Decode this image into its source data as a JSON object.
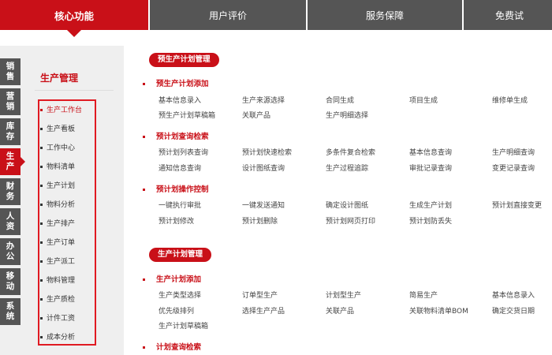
{
  "topnav": {
    "tabs": [
      "核心功能",
      "用户评价",
      "服务保障",
      "免费试"
    ]
  },
  "sidebar": {
    "vtabs": [
      "销售",
      "营销",
      "库存",
      "生产",
      "财务",
      "人资",
      "办公",
      "移动",
      "系统"
    ],
    "active_vtab": "生产",
    "title": "生产管理",
    "items": [
      "生产工作台",
      "生产看板",
      "工作中心",
      "物料清单",
      "生产计划",
      "物料分析",
      "生产排产",
      "生产订单",
      "生产派工",
      "物料管理",
      "生产质检",
      "计件工资",
      "成本分析"
    ],
    "active_item": "生产工作台"
  },
  "main": {
    "section1": {
      "title": "预生产计划管理",
      "groups": [
        {
          "title": "预生产计划添加",
          "rows": [
            [
              "基本信息录入",
              "生产来源选择",
              "合同生成",
              "项目生成",
              "维修单生成"
            ],
            [
              "预生产计划草稿箱",
              "关联产品",
              "生产明细选择"
            ]
          ]
        },
        {
          "title": "预计划查询检索",
          "rows": [
            [
              "预计划列表查询",
              "预计划快速检索",
              "多条件复合检索",
              "基本信息查询",
              "生产明细查询"
            ],
            [
              "通知信息查询",
              "设计图纸查询",
              "生产过程追踪",
              "审批记录查询",
              "变更记录查询"
            ]
          ]
        },
        {
          "title": "预计划操作控制",
          "rows": [
            [
              "一键执行审批",
              "一键发送通知",
              "确定设计图纸",
              "生成生产计划",
              "预计划直接变更"
            ],
            [
              "预计划修改",
              "预计划删除",
              "预计划网页打印",
              "预计划防丢失"
            ]
          ]
        }
      ]
    },
    "section2": {
      "title": "生产计划管理",
      "groups": [
        {
          "title": "生产计划添加",
          "rows": [
            [
              "生产类型选择",
              "订单型生产",
              "计划型生产",
              "简易生产",
              "基本信息录入"
            ],
            [
              "优先级排列",
              "选择生产产品",
              "关联产品",
              "关联物料清单BOM",
              "确定交货日期"
            ],
            [
              "生产计划草稿箱"
            ]
          ]
        },
        {
          "title": "计划查询检索",
          "rows": []
        }
      ]
    }
  }
}
